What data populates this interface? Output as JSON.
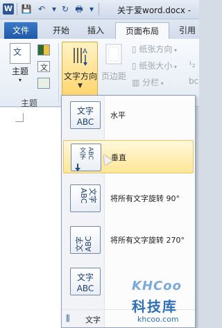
{
  "app": {
    "icon_letter": "W",
    "doc_title": "关于爱word.docx - "
  },
  "quick_access": {
    "save_icon": "save-icon",
    "undo_icon": "undo-icon",
    "redo_icon": "redo-icon",
    "print_icon": "print-icon"
  },
  "tabs": [
    {
      "label": "文件"
    },
    {
      "label": "开始"
    },
    {
      "label": "插入"
    },
    {
      "label": "页面布局"
    },
    {
      "label": "引用"
    }
  ],
  "ribbon": {
    "theme_label": "主题",
    "group_label": "主题",
    "text_direction_label": "文字方向",
    "margins_label": "页边距",
    "orientation_label": "纸张方向",
    "size_label": "纸张大小",
    "columns_label": "分栏"
  },
  "menu": {
    "items": [
      {
        "label": "水平",
        "icon": "horizontal-text-icon",
        "icon_text": "文字ABC"
      },
      {
        "label": "垂直",
        "icon": "vertical-text-icon",
        "icon_text": "文字ABC"
      },
      {
        "label": "将所有文字旋转 90°",
        "icon": "rotate-90-icon",
        "icon_text": "文字ABC"
      },
      {
        "label": "将所有文字旋转 270°",
        "icon": "rotate-270-icon",
        "icon_text": "文字ABC"
      },
      {
        "label": "",
        "icon": "stacked-text-icon",
        "icon_text": "文字ABC"
      }
    ],
    "footer_label": "文字"
  },
  "watermark": {
    "brand": "KHCoo",
    "cn": "科技库",
    "url": "khcoo.com"
  }
}
